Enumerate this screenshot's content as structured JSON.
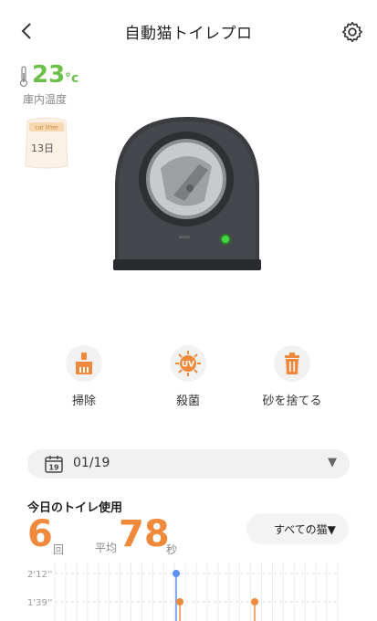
{
  "header": {
    "title": "自動猫トイレプロ"
  },
  "temperature": {
    "value": "23",
    "unit": "°c",
    "label": "庫内温度"
  },
  "litter": {
    "brand": "cat litter",
    "days": "13日"
  },
  "actions": [
    {
      "label": "掃除",
      "icon": "broom-icon"
    },
    {
      "label": "殺菌",
      "icon": "uv-sterilize-icon",
      "badge": "UV"
    },
    {
      "label": "砂を捨てる",
      "icon": "trash-icon"
    }
  ],
  "date_selector": {
    "value": "01/19",
    "calendar_day": "19",
    "arrow": "▼"
  },
  "usage": {
    "title": "今日のトイレ使用",
    "count": "6",
    "count_unit": "回",
    "avg_label": "平均",
    "avg_value": "78",
    "avg_unit": "秒",
    "cat_filter": "すべての猫▼"
  },
  "colors": {
    "accent": "#ef8a3c",
    "temp": "#6cc04a",
    "highlight": "#5b8ff9"
  },
  "chart_data": {
    "type": "scatter",
    "y_tick_labels": [
      "2'12''",
      "1'39''"
    ],
    "points": [
      {
        "y": "2'12''",
        "highlight": true
      },
      {
        "y": "1'39''",
        "highlight": false
      },
      {
        "y": "1'39''",
        "highlight": false
      }
    ]
  }
}
